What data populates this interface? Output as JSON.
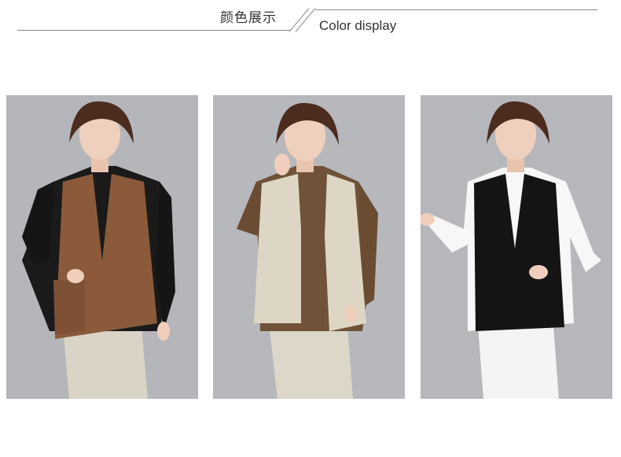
{
  "header": {
    "title_cn": "颜色展示",
    "title_en": "Color display"
  },
  "photos": [
    {
      "name": "brown-vest-model",
      "vest_color": "#8b5a3b",
      "shirt_color": "#1a1a1a",
      "pants_color": "#d9d4c6"
    },
    {
      "name": "beige-vest-model",
      "vest_color": "#ddd6c5",
      "shirt_color": "#6f5238",
      "pants_color": "#dcd7c8"
    },
    {
      "name": "black-vest-model",
      "vest_color": "#141414",
      "shirt_color": "#f7f7f7",
      "pants_color": "#f4f4f4"
    }
  ]
}
